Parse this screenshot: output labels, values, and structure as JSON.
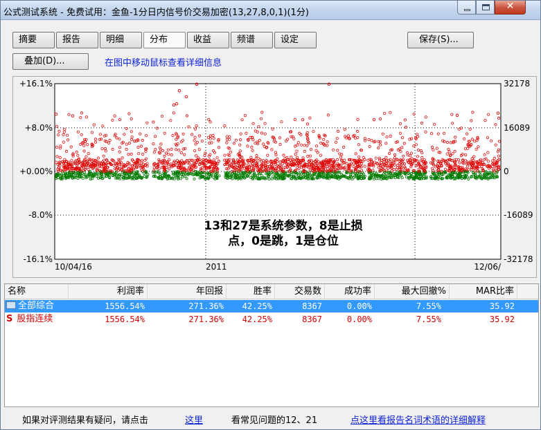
{
  "window": {
    "title": "公式测试系统 - 免费试用：金鱼-1分日内信号价交易加密(13,27,8,0,1)(1分)",
    "min_glyph": "—",
    "max_glyph": "□",
    "close_glyph": "✕"
  },
  "toolbar": {
    "tabs": [
      "摘要",
      "报告",
      "明细",
      "分布",
      "收益",
      "频谱",
      "设定"
    ],
    "active_tab": "分布",
    "save_label": "保存(S)...",
    "overlay_label": "叠加(D)...",
    "hint": "在图中移动鼠标查看详细信息"
  },
  "chart_data": {
    "type": "scatter",
    "y_left_ticks": [
      "+16.1%",
      "+8.0%",
      "+0.00%",
      "-8.0%",
      "-16.1%"
    ],
    "y_right_ticks": [
      "32178",
      "16089",
      "0",
      "-16089",
      "-32178"
    ],
    "x_ticks": [
      "10/04/16",
      "2011",
      "12/06/"
    ],
    "ylim": [
      -16.1,
      16.1
    ],
    "grid": true,
    "series": [
      {
        "color": "#e00000",
        "values_note_hidden": "",
        "range": [
          0.0,
          16.1
        ]
      },
      {
        "color": "#007a00",
        "range": [
          -1.5,
          0.0
        ]
      }
    ],
    "annotation_line1": "13和27是系统参数，8是止损",
    "annotation_line2": "点，0是跳，1是仓位",
    "colors": {
      "gain": "#e00000",
      "loss": "#007a00"
    }
  },
  "table": {
    "columns": [
      "名称",
      "利润率",
      "年回报",
      "胜率",
      "交易数",
      "成功率",
      "最大回撤%",
      "MAR比率"
    ],
    "rows": [
      {
        "name": "全部综合",
        "values": [
          "1556.54%",
          "271.36%",
          "42.25%",
          "8367",
          "0.00%",
          "7.55%",
          "35.92"
        ],
        "selected": true
      },
      {
        "prefix": "S",
        "name": "股指连续",
        "values": [
          "1556.54%",
          "271.36%",
          "42.25%",
          "8367",
          "0.00%",
          "7.55%",
          "35.92"
        ],
        "selected": false
      }
    ]
  },
  "footer": {
    "text1": "如果对评测结果有疑问，请点击",
    "link1": "这里",
    "text2": "看常见问题的12、21",
    "link2": "点这里看报告名词术语的详细解释"
  }
}
